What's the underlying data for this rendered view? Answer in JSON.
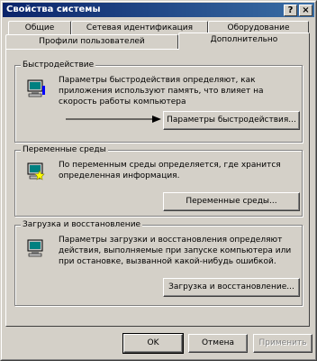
{
  "window": {
    "title": "Свойства системы"
  },
  "titlebar_buttons": {
    "help": "?",
    "close": "×"
  },
  "tabs": {
    "row1": [
      "Общие",
      "Сетевая идентификация",
      "Оборудование"
    ],
    "row2": [
      "Профили пользователей",
      "Дополнительно"
    ],
    "active": "Дополнительно"
  },
  "performance": {
    "title": "Быстродействие",
    "text": "Параметры быстродействия определяют, как приложения используют память, что влияет на скорость работы компьютера",
    "button": "Параметры быстродействия..."
  },
  "env": {
    "title": "Переменные среды",
    "text": "По переменным среды определяется, где хранится определенная информация.",
    "button": "Переменные среды..."
  },
  "startup": {
    "title": "Загрузка и восстановление",
    "text": "Параметры загрузки и восстановления определяют действия, выполняемые при запуске компьютера или при остановке, вызванной какой-нибудь ошибкой.",
    "button": "Загрузка и восстановление..."
  },
  "footer": {
    "ok": "OK",
    "cancel": "Отмена",
    "apply": "Применить"
  },
  "icons": {
    "help": "help-icon",
    "close": "close-icon",
    "computer": "computer-monitor-icon",
    "variables": "computer-star-icon",
    "arrow": "arrow-icon"
  }
}
